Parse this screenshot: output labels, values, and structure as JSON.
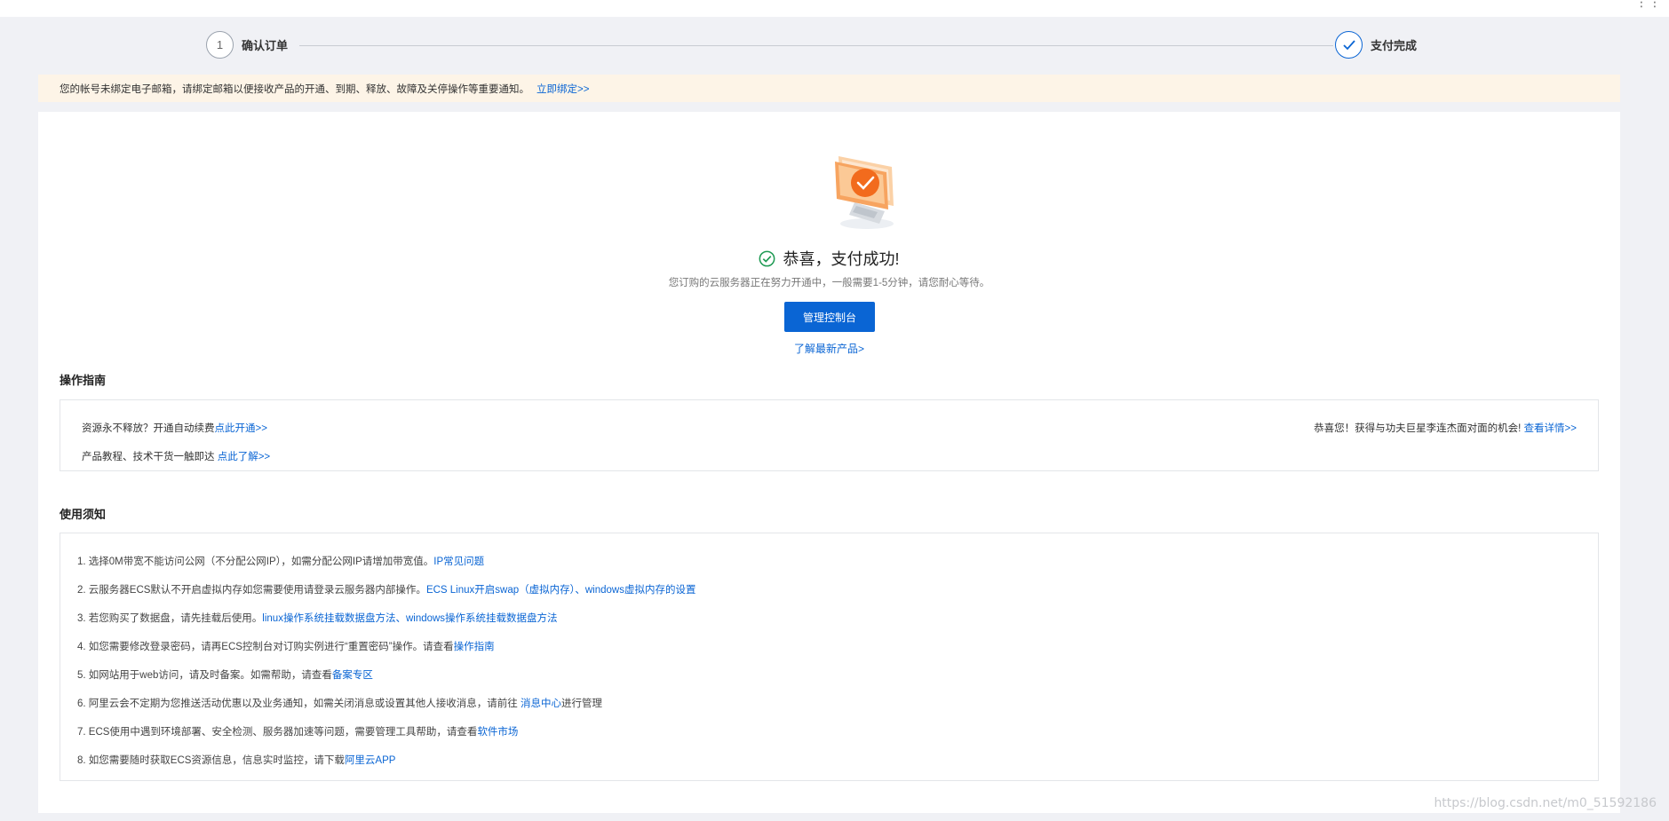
{
  "stepper": {
    "steps": [
      {
        "number": "1",
        "label": "确认订单"
      },
      {
        "label": "支付完成"
      }
    ]
  },
  "notice": {
    "text": "您的帐号未绑定电子邮箱，请绑定邮箱以便接收产品的开通、到期、释放、故障及关停操作等重要通知。",
    "link": "立即绑定>>"
  },
  "success": {
    "title": "恭喜，支付成功!",
    "subtitle": "您订购的云服务器正在努力开通中，一般需要1-5分钟，请您耐心等待。",
    "console_button": "管理控制台",
    "learn_link": "了解最新产品>"
  },
  "guide": {
    "title": "操作指南",
    "item1_text": "资源永不释放？开通自动续费",
    "item1_link": "点此开通>>",
    "item2_text": "产品教程、技术干货一触即达 ",
    "item2_link": "点此了解>>",
    "right_text": "恭喜您！获得与功夫巨星李连杰面对面的机会! ",
    "right_link": "查看详情>>"
  },
  "notes": {
    "title": "使用须知",
    "items": [
      {
        "text": "1. 选择0M带宽不能访问公网（不分配公网IP），如需分配公网IP请增加带宽值。",
        "links": [
          "IP常见问题"
        ]
      },
      {
        "text": "2. 云服务器ECS默认不开启虚拟内存如您需要使用请登录云服务器内部操作。",
        "links": [
          "ECS Linux开启swap（虚拟内存）",
          "、",
          "windows虚拟内存的设置"
        ]
      },
      {
        "text": "3. 若您购买了数据盘，请先挂载后使用。",
        "links": [
          "linux操作系统挂载数据盘方法",
          "、",
          "windows操作系统挂载数据盘方法"
        ]
      },
      {
        "text": "4. 如您需要修改登录密码，请再ECS控制台对订购实例进行“重置密码”操作。请查看",
        "links": [
          "操作指南"
        ]
      },
      {
        "text": "5. 如网站用于web访问，请及时备案。如需帮助，请查看",
        "links": [
          "备案专区"
        ]
      },
      {
        "text": "6. 阿里云会不定期为您推送活动优惠以及业务通知，如需关闭消息或设置其他人接收消息，请前往 ",
        "links": [
          "消息中心"
        ],
        "suffix": "进行管理"
      },
      {
        "text": "7. ECS使用中遇到环境部署、安全检测、服务器加速等问题，需要管理工具帮助，请查看",
        "links": [
          "软件市场"
        ]
      },
      {
        "text": "8. 如您需要随时获取ECS资源信息，信息实时监控，请下载",
        "links": [
          "阿里云APP"
        ]
      }
    ]
  },
  "watermark": "https://blog.csdn.net/m0_51592186",
  "colors": {
    "accent": "#0a65d4",
    "notice_bg": "#fdf4e7",
    "success_green": "#1e9a53",
    "page_bg": "#f0f1f5"
  },
  "icons": {
    "corner": "more-dots-icon",
    "step_done": "check-icon",
    "success": "success-check-circle-icon",
    "hero": "computer-success-illustration"
  }
}
